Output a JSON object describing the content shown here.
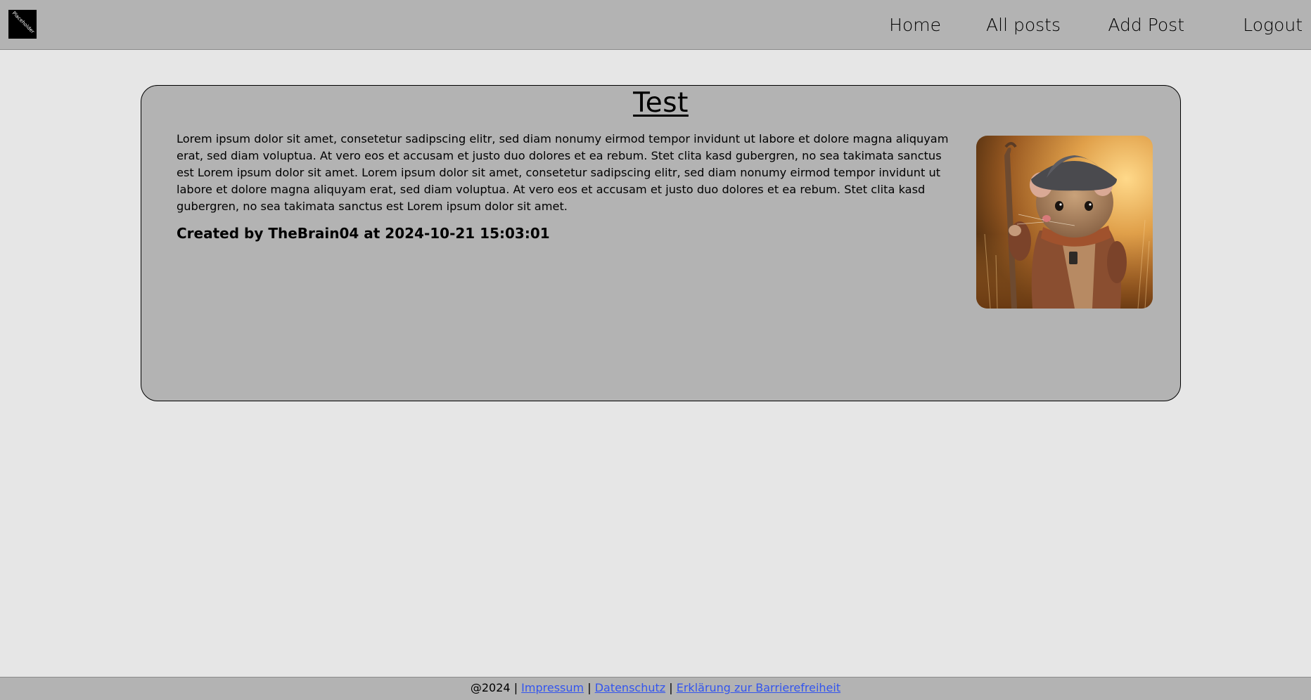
{
  "header": {
    "logo_text": "Placeholder",
    "nav": {
      "home": "Home",
      "all_posts": "All posts",
      "add_post": "Add Post",
      "logout": "Logout"
    }
  },
  "post": {
    "title": "Test",
    "body": "Lorem ipsum dolor sit amet, consetetur sadipscing elitr, sed diam nonumy eirmod tempor invidunt ut labore et dolore magna aliquyam erat, sed diam voluptua. At vero eos et accusam et justo duo dolores et ea rebum. Stet clita kasd gubergren, no sea takimata sanctus est Lorem ipsum dolor sit amet. Lorem ipsum dolor sit amet, consetetur sadipscing elitr, sed diam nonumy eirmod tempor invidunt ut labore et dolore magna aliquyam erat, sed diam voluptua. At vero eos et accusam et justo duo dolores et ea rebum. Stet clita kasd gubergren, no sea takimata sanctus est Lorem ipsum dolor sit amet.",
    "meta": "Created by TheBrain04 at 2024-10-21 15:03:01"
  },
  "footer": {
    "copyright": "@2024",
    "separator": "|",
    "links": {
      "impressum": "Impressum",
      "datenschutz": "Datenschutz",
      "barrierefreiheit": "Erklärung zur Barrierefreiheit"
    }
  },
  "colors": {
    "page_bg": "#e6e6e6",
    "bar_bg": "#b3b3b3",
    "card_bg": "#b3b3b3",
    "link": "#3355ee"
  }
}
